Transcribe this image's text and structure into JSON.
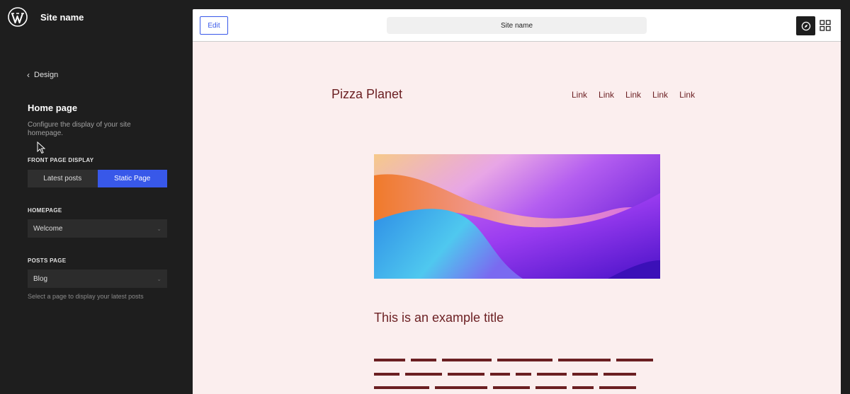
{
  "sidebar": {
    "site_name": "Site name",
    "back_label": "Design",
    "panel_title": "Home page",
    "panel_description": "Configure the display of your site homepage.",
    "front_page_display": {
      "label": "FRONT PAGE DISPLAY",
      "options": [
        "Latest posts",
        "Static Page"
      ],
      "selected": "Static Page"
    },
    "homepage": {
      "label": "HOMEPAGE",
      "value": "Welcome"
    },
    "posts_page": {
      "label": "POSTS PAGE",
      "value": "Blog",
      "help": "Select a page to display your latest posts"
    }
  },
  "toolbar": {
    "edit_label": "Edit",
    "url_title": "Site name"
  },
  "preview": {
    "brand": "Pizza Planet",
    "nav_links": [
      "Link",
      "Link",
      "Link",
      "Link",
      "Link"
    ],
    "post_title": "This is an example title"
  },
  "icons": {
    "logo": "wordpress-logo-icon",
    "back": "chevron-left-icon",
    "navigation": "compass-icon",
    "grid": "grid-icon"
  },
  "colors": {
    "accent": "#3858e9",
    "sidebar_bg": "#1e1e1e",
    "preview_bg": "#fbeeee",
    "brand_text": "#6b1f22"
  }
}
